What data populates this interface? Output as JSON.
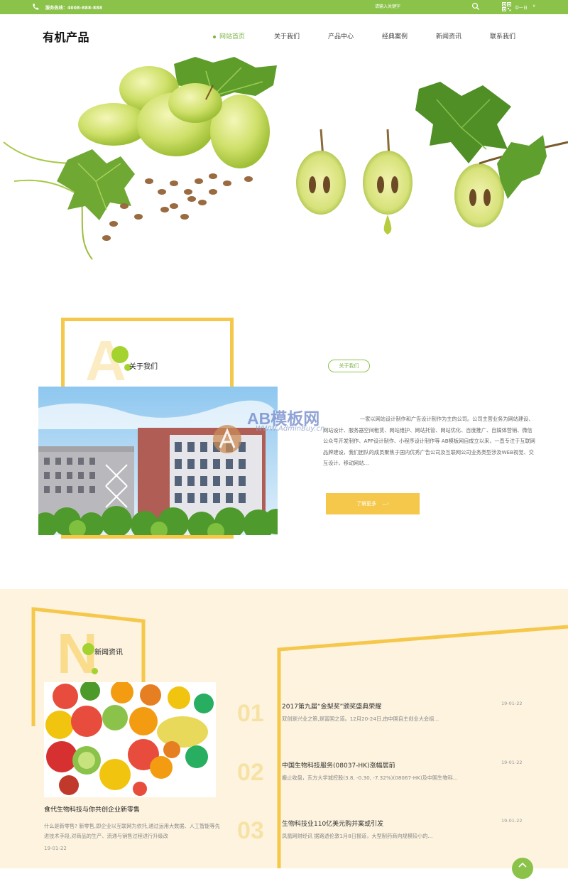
{
  "topbar": {
    "hotline": "服务热线：4008-888-888",
    "search_placeholder": "请输入关键字",
    "language": "中一日"
  },
  "header": {
    "logo": "有机产品",
    "nav": [
      {
        "label": "网站首页",
        "active": true
      },
      {
        "label": "关于我们",
        "active": false
      },
      {
        "label": "产品中心",
        "active": false
      },
      {
        "label": "经典案例",
        "active": false
      },
      {
        "label": "新闻资讯",
        "active": false
      },
      {
        "label": "联系我们",
        "active": false
      }
    ]
  },
  "about": {
    "letter": "A",
    "title": "关于我们",
    "badge": "关于我们",
    "text": "一家以网站设计制作和广告设计制作为主的公司。公司主营业务为网站建设、网站设计、服务器空间租赁、网站维护、网站托管、网站优化、百度推广、自媒体营销、微信公众号开发制作、APP设计制作、小程序设计制作等 AB模板网自成立以来，一直专注于互联网品牌建设，我们团队的成员聚焦于国内优秀广告公司及互联网公司业务类型涉及WEB视觉、交互设计、移动网站...",
    "more_label": "了解更多"
  },
  "watermark": {
    "brand": "AB模板网",
    "url": "WWW.AdminBuy.cn"
  },
  "news": {
    "letter": "N",
    "title": "新闻资讯",
    "feature": {
      "title": "食代生物科技与你共创企业新零售",
      "desc": "什么是新零售? 新零售,即企业以互联网为依托,通过运用大数据、人工智能等先进技术手段,对商品的生产、流通与销售过程进行升级改",
      "date": "19-01-22"
    },
    "items": [
      {
        "num": "01",
        "title": "2017第九届“金梨奖”颁奖盛典荣耀",
        "summary": "双创是兴业之策,是富国之道。12月20-24日,由中国自主创业大会组...",
        "date": "19-01-22"
      },
      {
        "num": "02",
        "title": "中国生物科技服务(08037-HK)涨幅居前",
        "summary": "搬止收盘，东方大学城控股(3.8, -0.30, -7.32%)(08067-HK)及中国生物科...",
        "date": "19-01-22"
      },
      {
        "num": "03",
        "title": "生物科技业110亿美元购并案或引发",
        "summary": "凤凰网财经讯 据路透伦敦1月8日报道，大型制药商向规模较小的...",
        "date": "19-01-22"
      }
    ]
  },
  "colors": {
    "green": "#8bc34a",
    "yellow": "#f5c84c",
    "cream": "#fdf3df"
  }
}
